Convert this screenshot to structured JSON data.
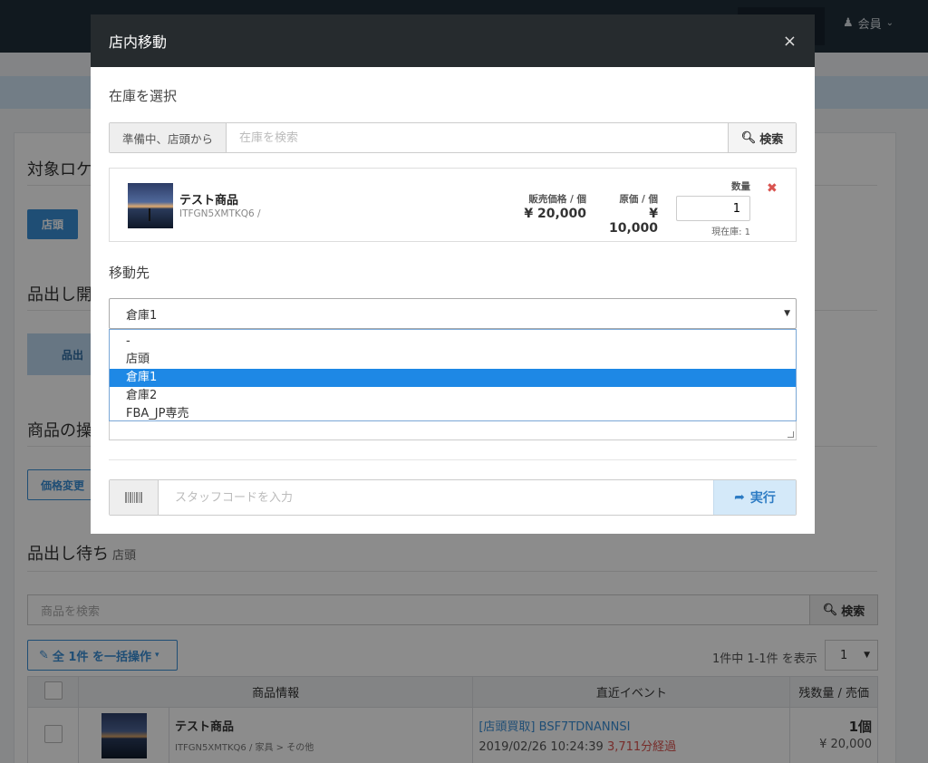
{
  "app": {
    "member_label": "会員",
    "sections": {
      "target_location": "対象ロケ",
      "start_picking": "品出し開",
      "product_ops": "商品の操"
    },
    "store_button": "店頭",
    "pick_button": "品出",
    "price_change_button": "価格変更",
    "waiting": {
      "title": "品出し待ち",
      "subtitle": "店頭",
      "search_placeholder": "商品を検索",
      "search_button": "検索",
      "bulk_button": "全 1件 を一括操作",
      "paging_text": "1件中 1-1件 を表示",
      "page_value": "1",
      "columns": [
        "商品情報",
        "直近イベント",
        "残数量 / 売価"
      ],
      "rows": [
        {
          "name": "テスト商品",
          "code": "ITFGN5XMTKQ6 / 家具 > その他",
          "event_link": "[店頭買取] BSF7TDNANNSI",
          "event_time": "2019/02/26 10:24:39",
          "event_elapsed": "3,711分経過",
          "qty": "1個",
          "price": "¥ 20,000"
        }
      ]
    }
  },
  "modal": {
    "title": "店内移動",
    "close": "×",
    "select_stock_label": "在庫を選択",
    "stock_filter_label": "準備中、店頭から",
    "stock_search_placeholder": "在庫を検索",
    "stock_search_button": "検索",
    "item": {
      "name": "テスト商品",
      "code": "ITFGN5XMTKQ6 /",
      "sale_price_label": "販売価格 / 個",
      "sale_price": "¥ 20,000",
      "cost_label": "原価 / 個",
      "cost": "¥ 10,000",
      "qty_label": "数量",
      "qty": "1",
      "current_stock": "現在庫: 1",
      "remove": "✖"
    },
    "destination_label": "移動先",
    "destination_selected": "倉庫1",
    "destination_options": [
      "-",
      "店頭",
      "倉庫1",
      "倉庫2",
      "FBA_JP専売"
    ],
    "staff_placeholder": "スタッフコードを入力",
    "execute_button": "実行"
  }
}
